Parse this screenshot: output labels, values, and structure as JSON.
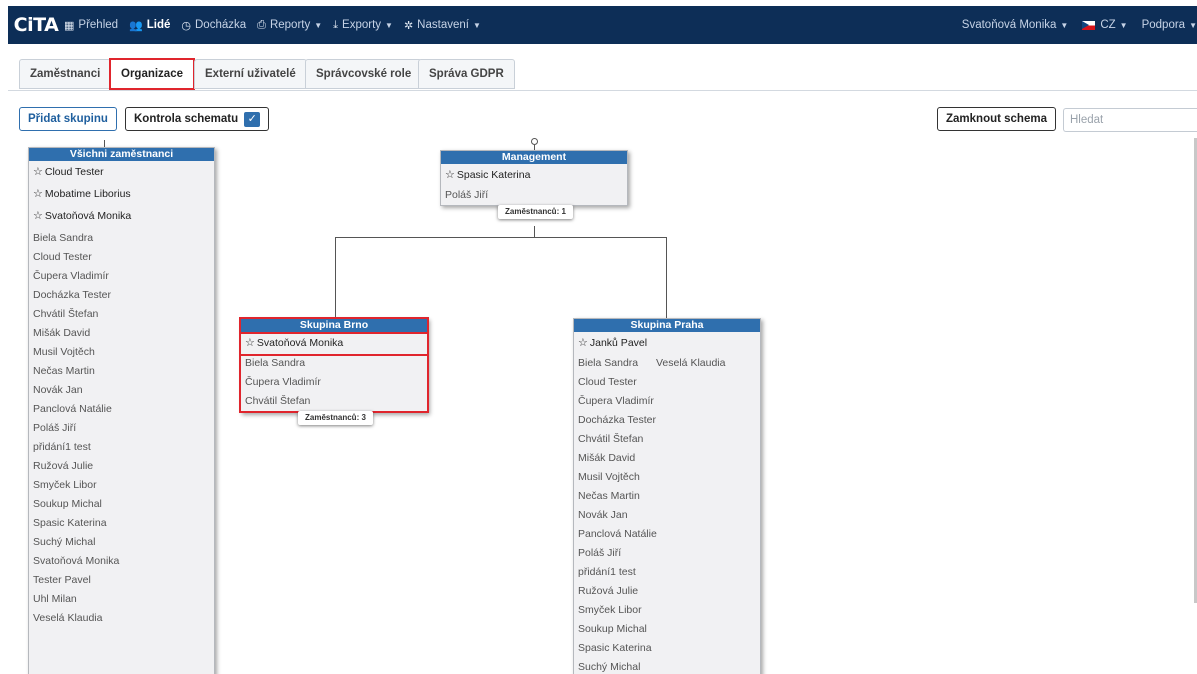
{
  "app": {
    "logo": "CiTA"
  },
  "nav": {
    "items": [
      {
        "label": "Přehled",
        "icon": "grid-icon"
      },
      {
        "label": "Lidé",
        "icon": "users-icon",
        "active": true
      },
      {
        "label": "Docházka",
        "icon": "clock-icon"
      },
      {
        "label": "Reporty",
        "icon": "printer-icon"
      },
      {
        "label": "Exporty",
        "icon": "export-icon"
      },
      {
        "label": "Nastavení",
        "icon": "gear-icon"
      }
    ],
    "user": "Svatoňová Monika",
    "language": "CZ",
    "support": "Podpora"
  },
  "tabs": [
    {
      "label": "Zaměstnanci"
    },
    {
      "label": "Organizace",
      "active": true
    },
    {
      "label": "Externí uživatelé"
    },
    {
      "label": "Správcovské role"
    },
    {
      "label": "Správa GDPR"
    }
  ],
  "actions": {
    "add_group": "Přidat skupinu",
    "schema_check": "Kontrola schematu",
    "lock_schema": "Zamknout schema",
    "search_placeholder": "Hledat"
  },
  "groups": {
    "all": {
      "title": "Všichni zaměstnanci",
      "leads": [
        "Cloud Tester",
        "Mobatime Liborius",
        "Svatoňová Monika"
      ],
      "members": [
        "Biela Sandra",
        "Cloud Tester",
        "Čupera Vladimír",
        "Docházka Tester",
        "Chvátil Štefan",
        "Mišák David",
        "Musil Vojtěch",
        "Nečas Martin",
        "Novák Jan",
        "Panclová Natálie",
        "Poláš Jiří",
        "přidání1 test",
        "Ružová Julie",
        "Smyček Libor",
        "Soukup Michal",
        "Spasic Katerina",
        "Suchý Michal",
        "Svatoňová Monika",
        "Tester Pavel",
        "Uhl Milan",
        "Veselá Klaudia"
      ]
    },
    "management": {
      "title": "Management",
      "leads": [
        "Spasic Katerina"
      ],
      "members": [
        "Poláš Jiří"
      ],
      "count_label": "Zaměstnanců: 1"
    },
    "brno": {
      "title": "Skupina Brno",
      "leads": [
        "Svatoňová Monika"
      ],
      "members": [
        "Biela Sandra",
        "Čupera Vladimír",
        "Chvátil Štefan"
      ],
      "count_label": "Zaměstnanců: 3"
    },
    "praha": {
      "title": "Skupina Praha",
      "leads": [
        "Janků Pavel"
      ],
      "members_col2": [
        "Veselá Klaudia"
      ],
      "members": [
        "Biela Sandra",
        "Cloud Tester",
        "Čupera Vladimír",
        "Docházka Tester",
        "Chvátil Štefan",
        "Mišák David",
        "Musil Vojtěch",
        "Nečas Martin",
        "Novák Jan",
        "Panclová Natálie",
        "Poláš Jiří",
        "přidání1 test",
        "Ružová Julie",
        "Smyček Libor",
        "Soukup Michal",
        "Spasic Katerina",
        "Suchý Michal"
      ]
    }
  }
}
